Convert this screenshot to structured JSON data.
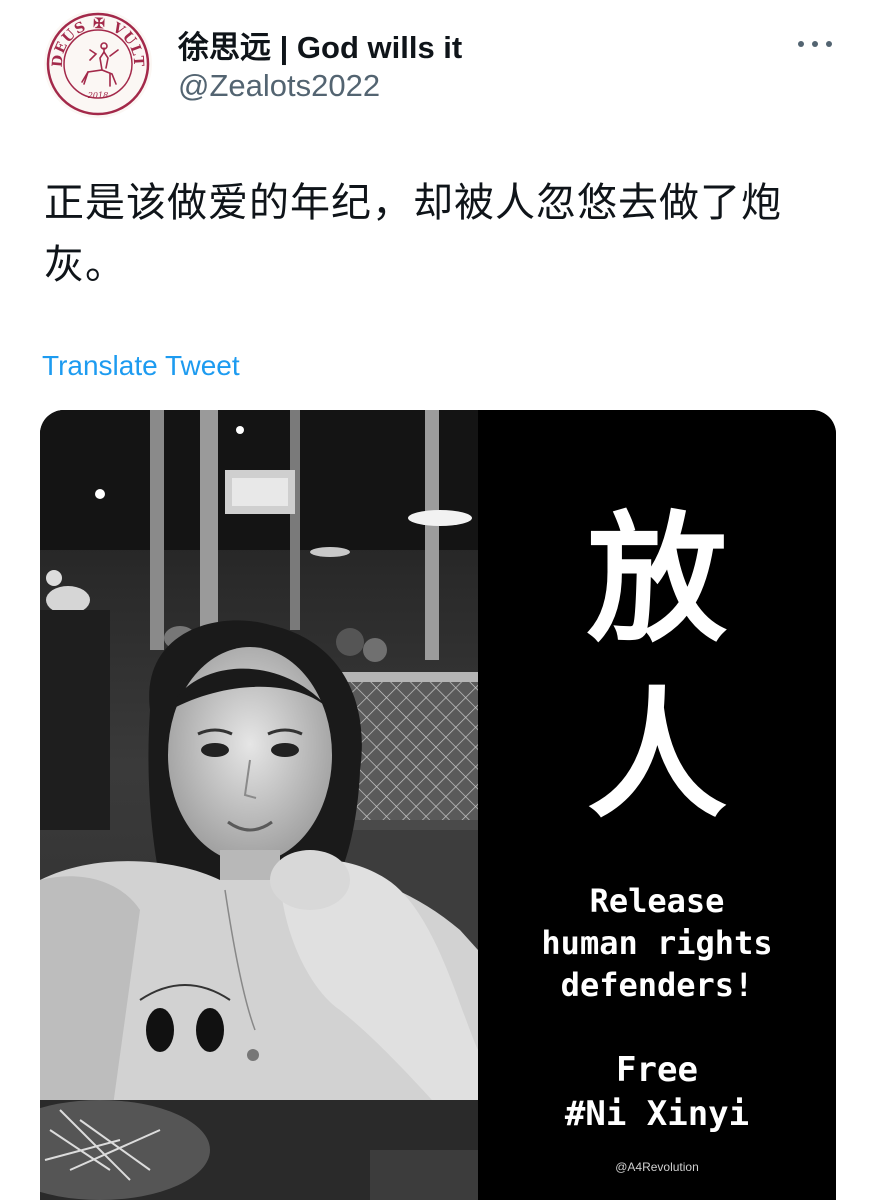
{
  "header": {
    "display_name": "徐思远 | God wills it",
    "handle": "@Zealots2022",
    "avatar": {
      "text_top": "DEUS ✠ VULT",
      "text_bottom": "2018",
      "color": "#a3294a"
    }
  },
  "tweet": {
    "text": "正是该做爱的年纪，却被人忽悠去做了炮灰。",
    "translate_label": "Translate Tweet"
  },
  "media": {
    "char_1": "放",
    "char_2": "人",
    "slogan_line_1": "Release",
    "slogan_line_2": "human rights",
    "slogan_line_3": "defenders!",
    "free_line_1": "Free",
    "free_line_2": "#Ni Xinyi",
    "credit": "@A4Revolution"
  },
  "colors": {
    "link": "#1d9bf0",
    "secondary_text": "#536471",
    "primary_text": "#0f1419"
  },
  "icons": {
    "more": "more-horizontal-icon"
  }
}
